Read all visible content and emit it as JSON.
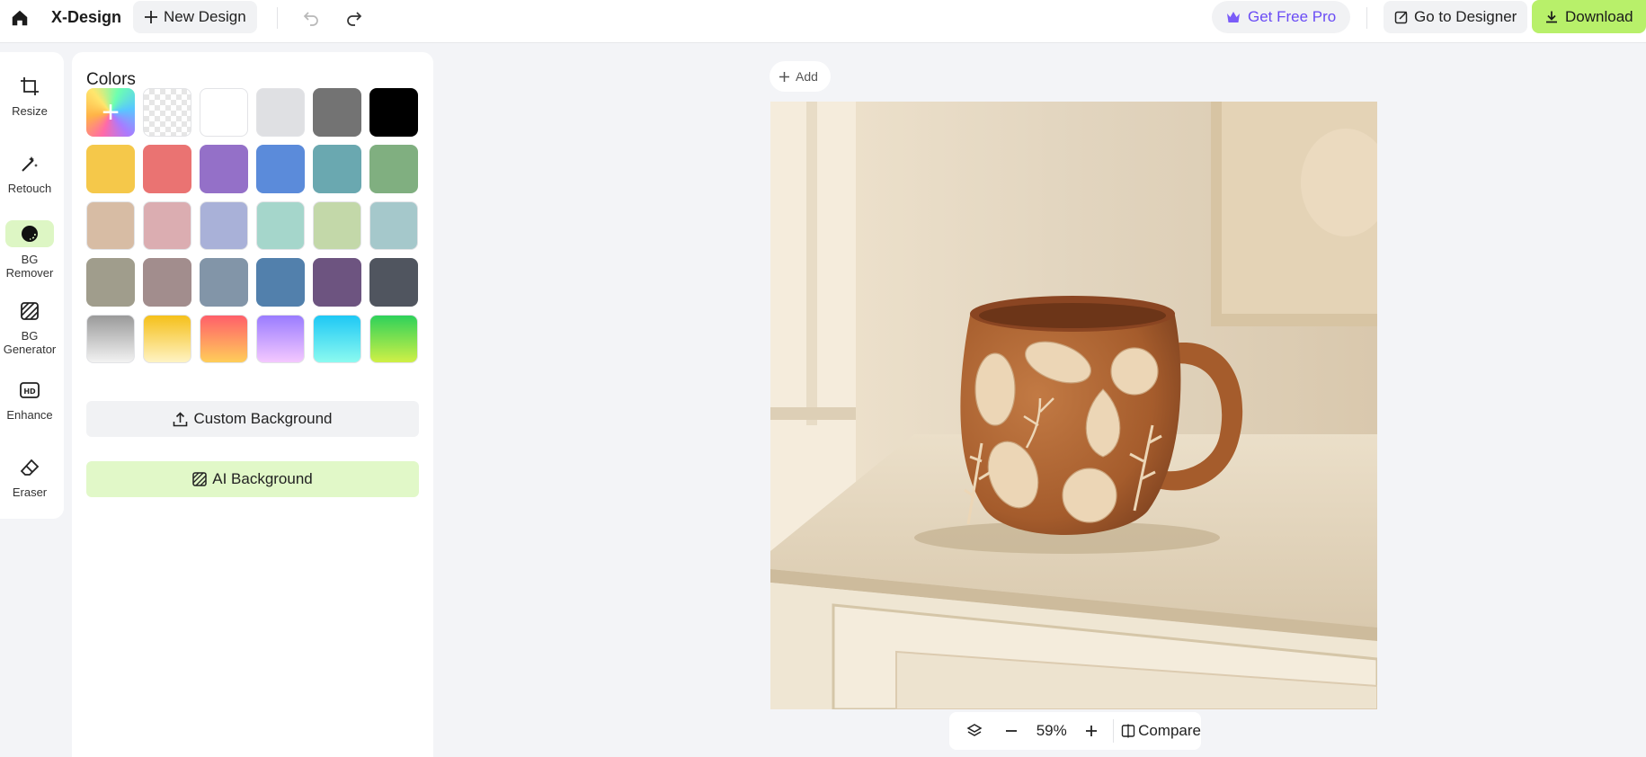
{
  "header": {
    "brand": "X-Design",
    "new_design_label": "New Design",
    "get_pro_label": "Get Free Pro",
    "go_to_designer_label": "Go to Designer",
    "download_label": "Download"
  },
  "tools": [
    {
      "label": "Resize",
      "icon": "crop-icon"
    },
    {
      "label": "Retouch",
      "icon": "magic-wand-icon"
    },
    {
      "label": "BG\nRemover",
      "icon": "bg-remover-icon",
      "active": true
    },
    {
      "label": "BG\nGenerator",
      "icon": "bg-generator-icon"
    },
    {
      "label": "Enhance",
      "icon": "hd-icon"
    },
    {
      "label": "Eraser",
      "icon": "eraser-icon"
    }
  ],
  "colors_panel": {
    "title": "Colors",
    "swatches": [
      [
        "add-custom",
        "transparent",
        "#ffffff",
        "#dfe0e3",
        "#737373",
        "#000000"
      ],
      [
        "#f5c84a",
        "#ea7372",
        "#9470c8",
        "#5b8bda",
        "#6aa8b0",
        "#80af80"
      ],
      [
        "#d7bca4",
        "#dbadb1",
        "#a9b1d8",
        "#a5d6cb",
        "#c3d8a9",
        "#a5c8cb"
      ],
      [
        "#a09d8c",
        "#a28d8d",
        "#8295a8",
        "#5280ac",
        "#6d5480",
        "#50555f"
      ],
      [
        "linear-gradient(180deg,#9a9a9a,#f2f2f2)",
        "linear-gradient(180deg,#f5c01a,#fff3c4)",
        "linear-gradient(180deg,#ff5f6a,#ffce5a)",
        "linear-gradient(180deg,#9a7cff,#f4c8ff)",
        "linear-gradient(180deg,#1ec8f5,#8cfaf0)",
        "linear-gradient(180deg,#2ed15a,#d0f046)"
      ]
    ],
    "custom_bg_label": "Custom Background",
    "ai_bg_label": "AI Background"
  },
  "canvas": {
    "add_label": "Add"
  },
  "zoom": {
    "level": "59%",
    "compare_label": "Compare"
  },
  "colors": {
    "accent_green": "#b8f06a",
    "pro_purple": "#6a4cf5"
  }
}
